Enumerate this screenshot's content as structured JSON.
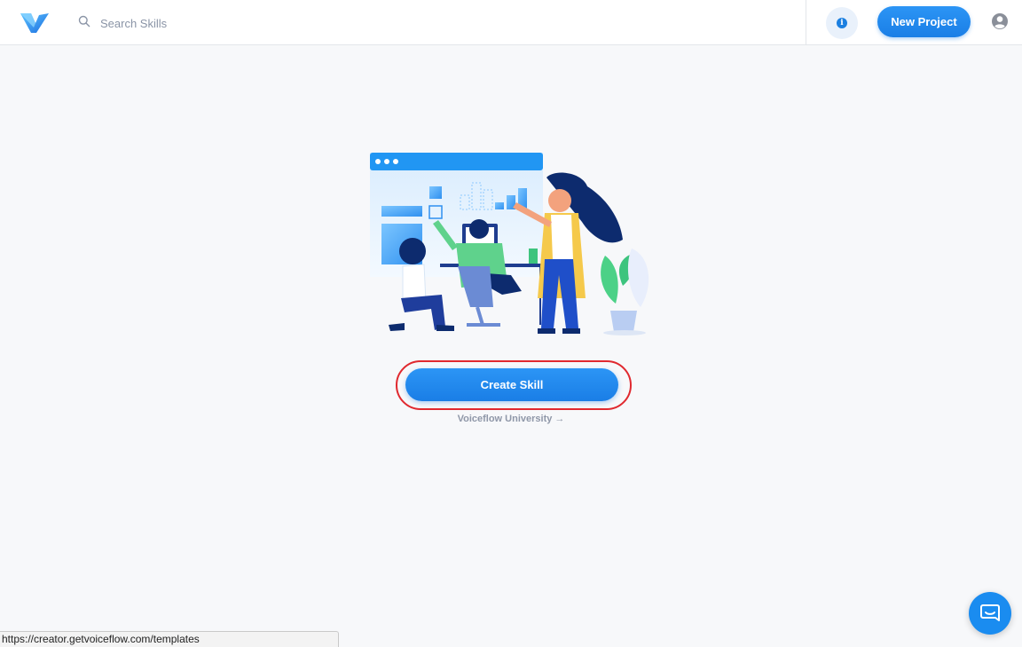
{
  "header": {
    "logo_icon": "voiceflow-logo-icon",
    "search": {
      "placeholder": "Search Skills",
      "value": "",
      "icon": "search-icon"
    },
    "info_icon": "info-icon",
    "info_glyph": "i",
    "new_project_label": "New Project",
    "account_icon": "user-account-icon"
  },
  "main": {
    "illustration_icon": "team-collaboration-illustration",
    "create_skill_label": "Create Skill",
    "university_link_label": "Voiceflow University",
    "university_link_arrow": "→"
  },
  "chat_widget_icon": "chat-bubble-icon",
  "status_bar": {
    "url": "https://creator.getvoiceflow.com/templates"
  },
  "colors": {
    "accent": "#1a7ee6",
    "highlight_ring": "#e0292f",
    "background": "#f7f8fa"
  }
}
